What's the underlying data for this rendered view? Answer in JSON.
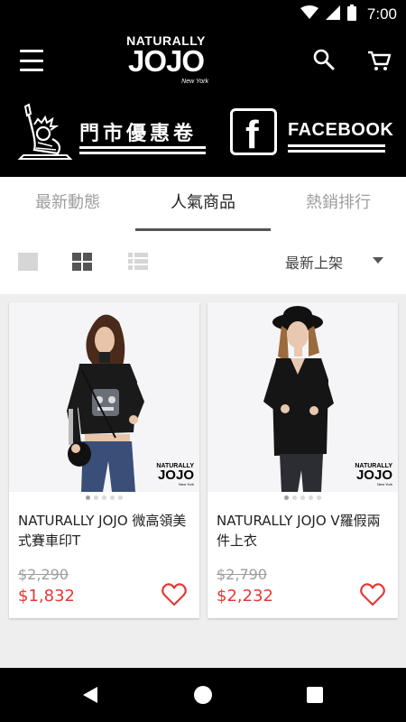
{
  "status_bar": {
    "time": "7:00",
    "icons": [
      "wifi-icon",
      "signal-icon",
      "battery-icon"
    ]
  },
  "header": {
    "logo_top": "NATURALLY",
    "logo_main": "JOJO",
    "logo_sub": "New York",
    "icons": [
      "menu-icon",
      "search-icon",
      "cart-icon"
    ]
  },
  "banner": {
    "store_coupon_label": "門市優惠卷",
    "facebook_label": "FACEBOOK"
  },
  "tabs": [
    {
      "label": "最新動態",
      "active": false
    },
    {
      "label": "人氣商品",
      "active": true
    },
    {
      "label": "熱銷排行",
      "active": false
    }
  ],
  "toolbar": {
    "view_modes": [
      "single-view-icon",
      "grid-view-icon",
      "list-view-icon"
    ],
    "sort_label": "最新上架"
  },
  "products": [
    {
      "name": "NATURALLY JOJO 微高領美式賽車印T",
      "original_price": "$2,290",
      "price": "$1,832",
      "image_logo_top": "NATURALLY",
      "image_logo_main": "JOJO",
      "image_logo_sub": "New York",
      "image_count": 5,
      "active_image": 1
    },
    {
      "name": "NATURALLY JOJO V羅假兩件上衣",
      "original_price": "$2,790",
      "price": "$2,232",
      "image_logo_top": "NATURALLY",
      "image_logo_main": "JOJO",
      "image_logo_sub": "New York",
      "image_count": 5,
      "active_image": 1
    }
  ],
  "colors": {
    "header_bg": "#000000",
    "price_red": "#e53935",
    "tab_active": "#222222",
    "tab_inactive": "#9e9e9e"
  }
}
